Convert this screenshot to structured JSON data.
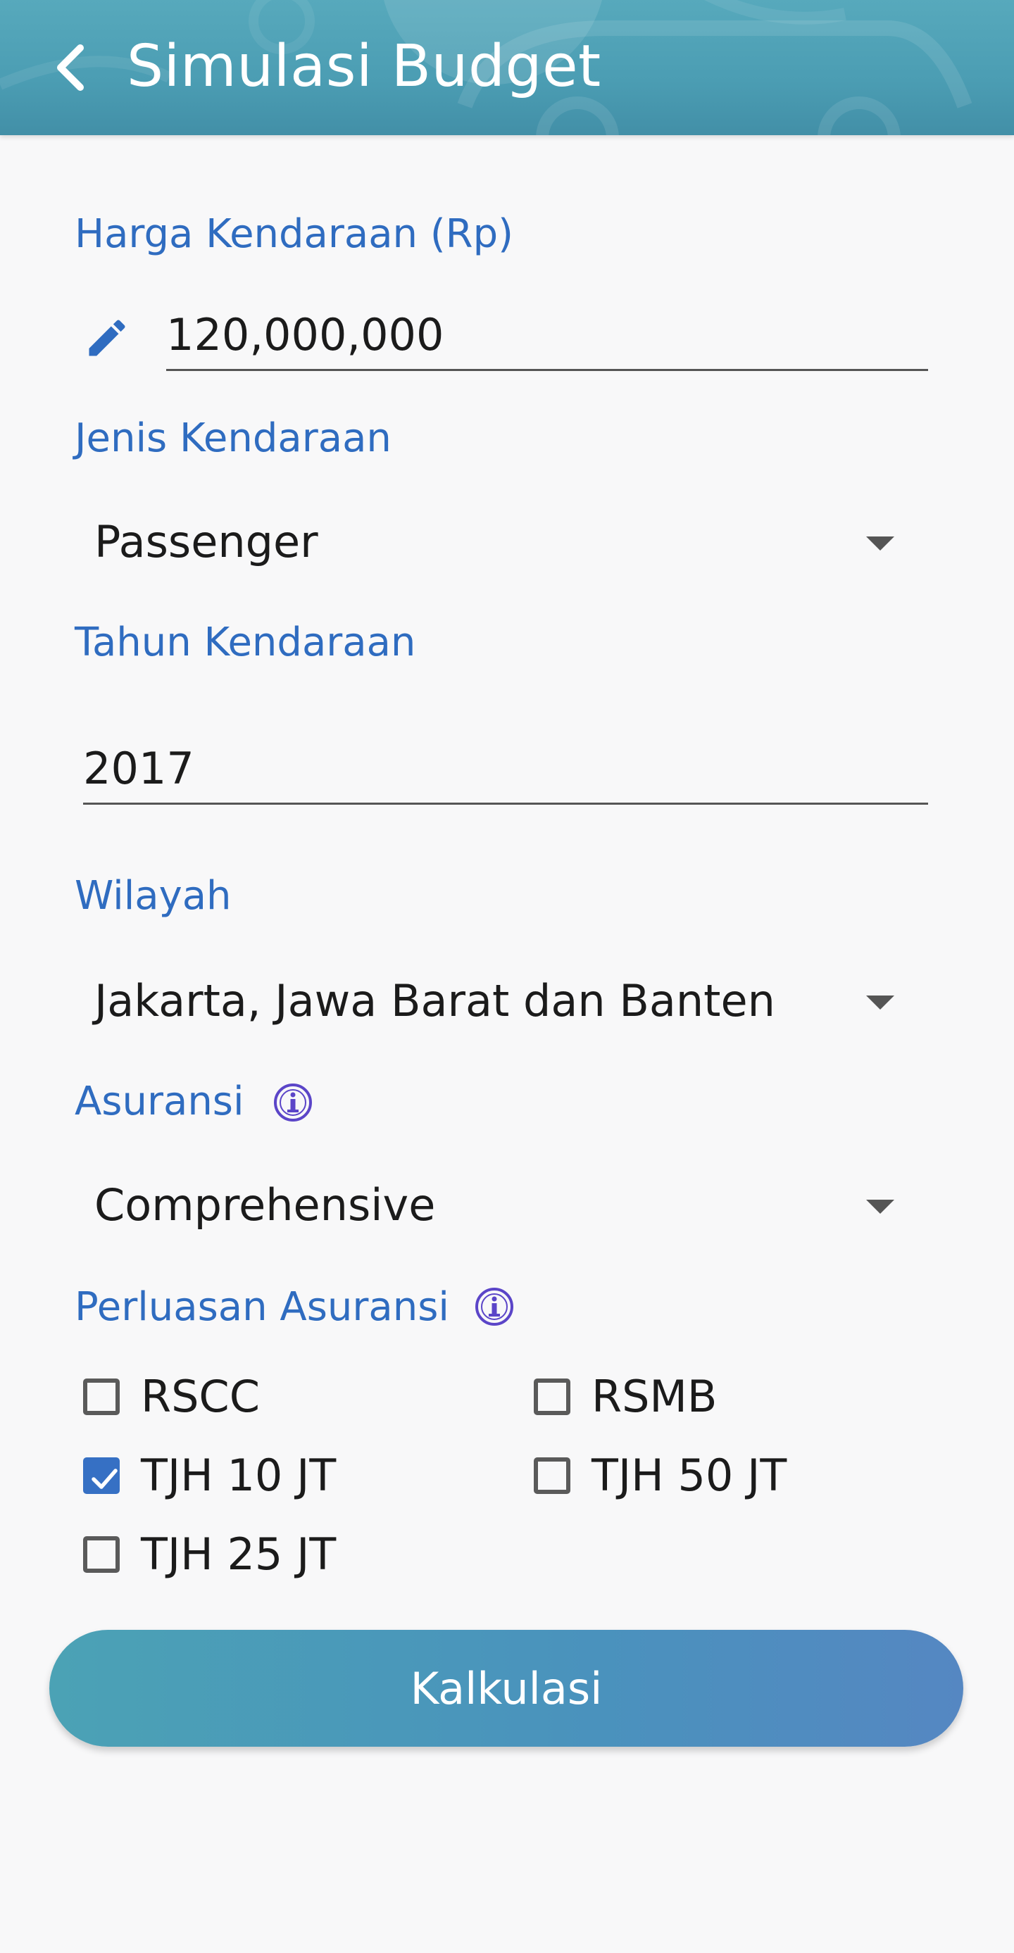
{
  "header": {
    "title": "Simulasi Budget",
    "back_icon": "chevron-left-icon"
  },
  "form": {
    "price": {
      "label": "Harga Kendaraan (Rp)",
      "value": "120,000,000",
      "icon": "pencil-icon"
    },
    "vehicle_type": {
      "label": "Jenis Kendaraan",
      "selected": "Passenger"
    },
    "vehicle_year": {
      "label": "Tahun Kendaraan",
      "value": "2017"
    },
    "region": {
      "label": "Wilayah",
      "selected": "Jakarta, Jawa Barat dan Banten"
    },
    "insurance": {
      "label": "Asuransi",
      "selected": "Comprehensive",
      "info_icon": "info-icon"
    },
    "extension": {
      "label": "Perluasan Asuransi",
      "info_icon": "info-icon",
      "options": [
        {
          "label": "RSCC",
          "checked": false
        },
        {
          "label": "RSMB",
          "checked": false
        },
        {
          "label": "TJH 10 JT",
          "checked": true
        },
        {
          "label": "TJH 50 JT",
          "checked": false
        },
        {
          "label": "TJH 25 JT",
          "checked": false
        }
      ]
    }
  },
  "actions": {
    "calculate_label": "Kalkulasi"
  },
  "colors": {
    "primary": "#4b9db3",
    "label": "#2f6cc0",
    "checkbox_checked": "#3670c4",
    "info": "#5b45c8"
  }
}
